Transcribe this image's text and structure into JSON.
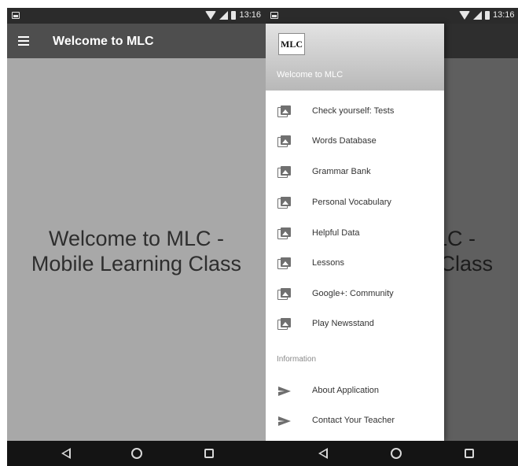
{
  "status_bar": {
    "time": "13:16"
  },
  "toolbar": {
    "title": "Welcome to MLC"
  },
  "content": {
    "welcome_line1": "Welcome to MLC -",
    "welcome_line2": "Mobile Learning Class"
  },
  "drawer": {
    "logo_text": "MLC",
    "header_title": "Welcome to MLC",
    "items": [
      {
        "label": "Check yourself: Tests",
        "icon": "photo-library-icon"
      },
      {
        "label": "Words Database",
        "icon": "photo-library-icon"
      },
      {
        "label": "Grammar Bank",
        "icon": "photo-library-icon"
      },
      {
        "label": "Personal Vocabulary",
        "icon": "photo-library-icon"
      },
      {
        "label": "Helpful Data",
        "icon": "photo-library-icon"
      },
      {
        "label": "Lessons",
        "icon": "photo-library-icon"
      },
      {
        "label": "Google+: Community",
        "icon": "photo-library-icon"
      },
      {
        "label": "Play Newsstand",
        "icon": "photo-library-icon"
      }
    ],
    "section_header": "Information",
    "info_items": [
      {
        "label": "About Application",
        "icon": "send-icon"
      },
      {
        "label": "Contact Your Teacher",
        "icon": "send-icon"
      }
    ]
  },
  "colors": {
    "toolbar": "#4e4e4e",
    "content_background": "#a8a8a8",
    "scrim_content": "#5f5f5f",
    "status_bar": "#2b2b2b",
    "nav_bar": "#141414",
    "drawer_background": "#ffffff"
  }
}
